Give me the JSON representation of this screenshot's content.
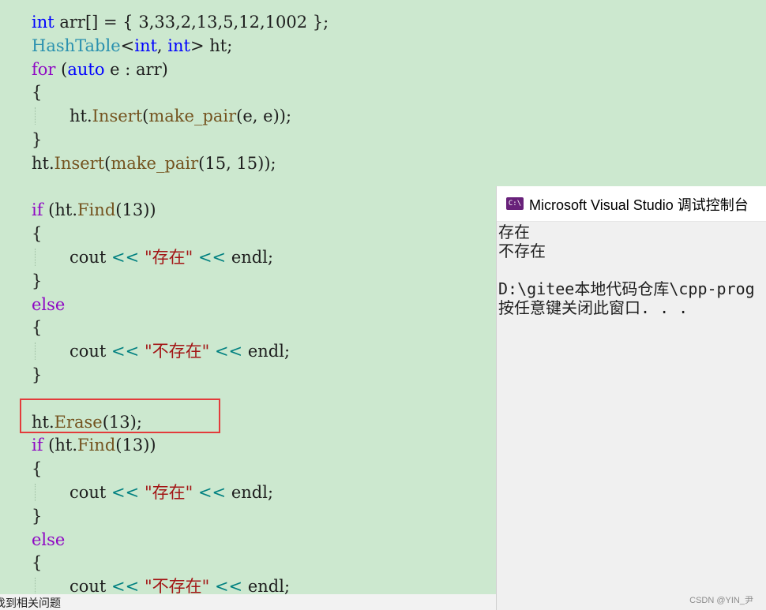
{
  "editor": {
    "lines": [
      {
        "tokens": [
          {
            "t": "int",
            "c": "kw"
          },
          {
            "t": " arr[] = { 3,33,2,13,5,12,1002 };",
            "c": ""
          }
        ]
      },
      {
        "tokens": [
          {
            "t": "HashTable",
            "c": "type"
          },
          {
            "t": "<",
            "c": ""
          },
          {
            "t": "int",
            "c": "kw"
          },
          {
            "t": ", ",
            "c": ""
          },
          {
            "t": "int",
            "c": "kw"
          },
          {
            "t": "> ht;",
            "c": ""
          }
        ]
      },
      {
        "tokens": [
          {
            "t": "for",
            "c": "kw2"
          },
          {
            "t": " (",
            "c": ""
          },
          {
            "t": "auto",
            "c": "kw"
          },
          {
            "t": " e : arr)",
            "c": ""
          }
        ]
      },
      {
        "tokens": [
          {
            "t": "{",
            "c": ""
          }
        ]
      },
      {
        "indent": 1,
        "tokens": [
          {
            "t": "ht.",
            "c": ""
          },
          {
            "t": "Insert",
            "c": "fn"
          },
          {
            "t": "(",
            "c": ""
          },
          {
            "t": "make_pair",
            "c": "fn"
          },
          {
            "t": "(e, e));",
            "c": ""
          }
        ]
      },
      {
        "tokens": [
          {
            "t": "}",
            "c": ""
          }
        ]
      },
      {
        "tokens": [
          {
            "t": "ht.",
            "c": ""
          },
          {
            "t": "Insert",
            "c": "fn"
          },
          {
            "t": "(",
            "c": ""
          },
          {
            "t": "make_pair",
            "c": "fn"
          },
          {
            "t": "(15, 15));",
            "c": ""
          }
        ]
      },
      {
        "tokens": []
      },
      {
        "tokens": [
          {
            "t": "if",
            "c": "kw2"
          },
          {
            "t": " (ht.",
            "c": ""
          },
          {
            "t": "Find",
            "c": "fn"
          },
          {
            "t": "(13))",
            "c": ""
          }
        ]
      },
      {
        "tokens": [
          {
            "t": "{",
            "c": ""
          }
        ]
      },
      {
        "indent": 1,
        "tokens": [
          {
            "t": "cout ",
            "c": ""
          },
          {
            "t": "<<",
            "c": "op"
          },
          {
            "t": " ",
            "c": ""
          },
          {
            "t": "\"存在\"",
            "c": "str"
          },
          {
            "t": " ",
            "c": ""
          },
          {
            "t": "<<",
            "c": "op"
          },
          {
            "t": " endl;",
            "c": ""
          }
        ]
      },
      {
        "tokens": [
          {
            "t": "}",
            "c": ""
          }
        ]
      },
      {
        "tokens": [
          {
            "t": "else",
            "c": "kw2"
          }
        ]
      },
      {
        "tokens": [
          {
            "t": "{",
            "c": ""
          }
        ]
      },
      {
        "indent": 1,
        "tokens": [
          {
            "t": "cout ",
            "c": ""
          },
          {
            "t": "<<",
            "c": "op"
          },
          {
            "t": " ",
            "c": ""
          },
          {
            "t": "\"不存在\"",
            "c": "str"
          },
          {
            "t": " ",
            "c": ""
          },
          {
            "t": "<<",
            "c": "op"
          },
          {
            "t": " endl;",
            "c": ""
          }
        ]
      },
      {
        "tokens": [
          {
            "t": "}",
            "c": ""
          }
        ]
      },
      {
        "tokens": []
      },
      {
        "tokens": [
          {
            "t": "ht.",
            "c": ""
          },
          {
            "t": "Erase",
            "c": "fn"
          },
          {
            "t": "(13);",
            "c": ""
          }
        ]
      },
      {
        "tokens": [
          {
            "t": "if",
            "c": "kw2"
          },
          {
            "t": " (ht.",
            "c": ""
          },
          {
            "t": "Find",
            "c": "fn"
          },
          {
            "t": "(13))",
            "c": ""
          }
        ]
      },
      {
        "tokens": [
          {
            "t": "{",
            "c": ""
          }
        ]
      },
      {
        "indent": 1,
        "tokens": [
          {
            "t": "cout ",
            "c": ""
          },
          {
            "t": "<<",
            "c": "op"
          },
          {
            "t": " ",
            "c": ""
          },
          {
            "t": "\"存在\"",
            "c": "str"
          },
          {
            "t": " ",
            "c": ""
          },
          {
            "t": "<<",
            "c": "op"
          },
          {
            "t": " endl;",
            "c": ""
          }
        ]
      },
      {
        "tokens": [
          {
            "t": "}",
            "c": ""
          }
        ]
      },
      {
        "tokens": [
          {
            "t": "else",
            "c": "kw2"
          }
        ]
      },
      {
        "tokens": [
          {
            "t": "{",
            "c": ""
          }
        ]
      },
      {
        "indent": 1,
        "tokens": [
          {
            "t": "cout ",
            "c": ""
          },
          {
            "t": "<<",
            "c": "op"
          },
          {
            "t": " ",
            "c": ""
          },
          {
            "t": "\"不存在\"",
            "c": "str"
          },
          {
            "t": " ",
            "c": ""
          },
          {
            "t": "<<",
            "c": "op"
          },
          {
            "t": " endl;",
            "c": ""
          }
        ]
      }
    ]
  },
  "console": {
    "icon_label": "C:\\",
    "title": "Microsoft Visual Studio 调试控制台",
    "output": [
      "存在",
      "不存在",
      "",
      "D:\\gitee本地代码仓库\\cpp-prog",
      "按任意键关闭此窗口. . ."
    ]
  },
  "status_bar": {
    "text": "找到相关问题"
  },
  "watermark": "CSDN @YIN_尹",
  "colors": {
    "editor_bg": "#cce8cf",
    "highlight": "#e33b3b",
    "console_bg": "#f0f0f0"
  }
}
